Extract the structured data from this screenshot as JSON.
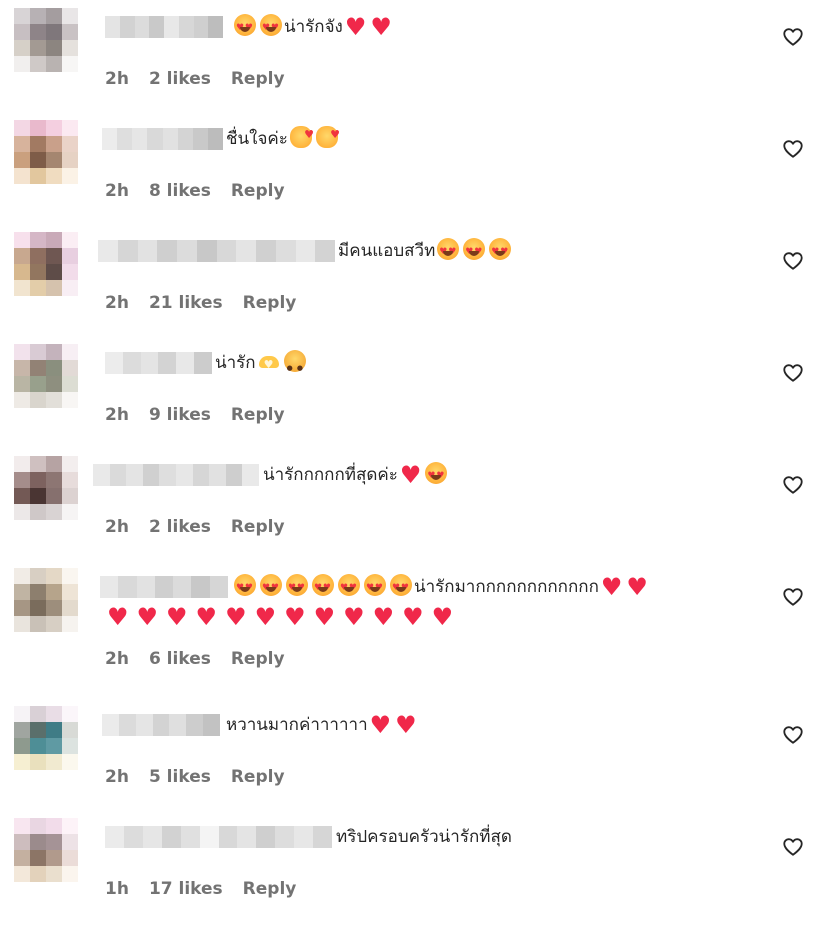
{
  "comments": [
    {
      "text": "น่ารักจัง",
      "emojis_before": [
        "heart-eyes",
        "heart-eyes"
      ],
      "emojis_after": [
        "heart",
        "heart"
      ],
      "time": "2h",
      "likes": "2 likes",
      "reply": "Reply"
    },
    {
      "text": "ชื่นใจค่ะ",
      "emojis_before": [],
      "emojis_after": [
        "hug",
        "hug"
      ],
      "time": "2h",
      "likes": "8 likes",
      "reply": "Reply"
    },
    {
      "text": "มีคนแอบสวีท",
      "emojis_before": [],
      "emojis_after": [
        "heart-eyes",
        "heart-eyes",
        "heart-eyes"
      ],
      "time": "2h",
      "likes": "21 likes",
      "reply": "Reply"
    },
    {
      "text": "น่ารัก",
      "emojis_before": [],
      "emojis_after": [
        "heart-hands",
        "pleading"
      ],
      "time": "2h",
      "likes": "9 likes",
      "reply": "Reply"
    },
    {
      "text": "น่ารักกกกกที่สุดค่ะ",
      "emojis_before": [],
      "emojis_after": [
        "heart",
        "heart-eyes"
      ],
      "time": "2h",
      "likes": "2 likes",
      "reply": "Reply"
    },
    {
      "text": "น่ารักมากกกกกกกกกกกก",
      "emojis_before": [
        "heart-eyes",
        "heart-eyes",
        "heart-eyes",
        "heart-eyes",
        "heart-eyes",
        "heart-eyes",
        "heart-eyes"
      ],
      "emojis_after": [
        "heart",
        "heart"
      ],
      "emojis_line2": [
        "heart",
        "heart",
        "heart",
        "heart",
        "heart",
        "heart",
        "heart",
        "heart",
        "heart",
        "heart",
        "heart",
        "heart"
      ],
      "time": "2h",
      "likes": "6 likes",
      "reply": "Reply"
    },
    {
      "text": "หวานมากค่าาาาาา",
      "emojis_before": [],
      "emojis_after": [
        "heart",
        "heart"
      ],
      "time": "2h",
      "likes": "5 likes",
      "reply": "Reply"
    },
    {
      "text": "ทริปครอบครัวน่ารักที่สุด",
      "emojis_before": [],
      "emojis_after": [],
      "time": "1h",
      "likes": "17 likes",
      "reply": "Reply"
    }
  ],
  "colors": {
    "text": "#262626",
    "meta": "#737373",
    "heart": "#f0284a"
  },
  "icons": {
    "like": "heart-outline-icon"
  }
}
